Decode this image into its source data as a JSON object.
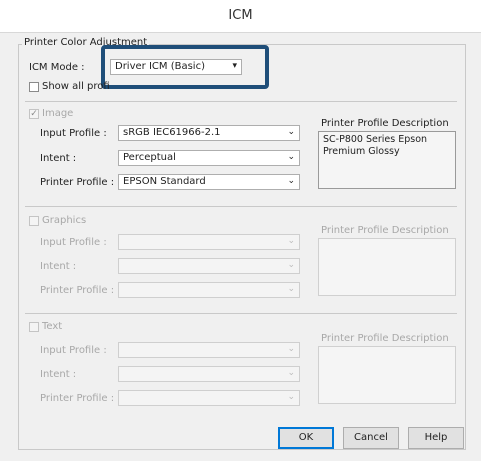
{
  "window": {
    "title": "ICM"
  },
  "adjustment": {
    "group_label": "Printer Color Adjustment",
    "icm_mode_label": "ICM Mode :",
    "icm_mode_value": "Driver ICM (Basic)",
    "show_all_label": "Show all profi"
  },
  "image": {
    "label": "Image",
    "checked": true,
    "input_profile_label": "Input Profile :",
    "input_profile_value": "sRGB IEC61966-2.1",
    "intent_label": "Intent :",
    "intent_value": "Perceptual",
    "printer_profile_label": "Printer Profile :",
    "printer_profile_value": "EPSON Standard",
    "desc_label": "Printer Profile Description",
    "desc_text": "SC-P800 Series Epson Premium Glossy"
  },
  "graphics": {
    "label": "Graphics",
    "input_profile_label": "Input Profile :",
    "intent_label": "Intent :",
    "printer_profile_label": "Printer Profile :",
    "desc_label": "Printer Profile Description"
  },
  "text": {
    "label": "Text",
    "input_profile_label": "Input Profile :",
    "intent_label": "Intent :",
    "printer_profile_label": "Printer Profile :",
    "desc_label": "Printer Profile Description"
  },
  "buttons": {
    "ok": "OK",
    "cancel": "Cancel",
    "help": "Help"
  },
  "colors": {
    "highlight": "#1f4e79",
    "default_button": "#0078d7"
  }
}
